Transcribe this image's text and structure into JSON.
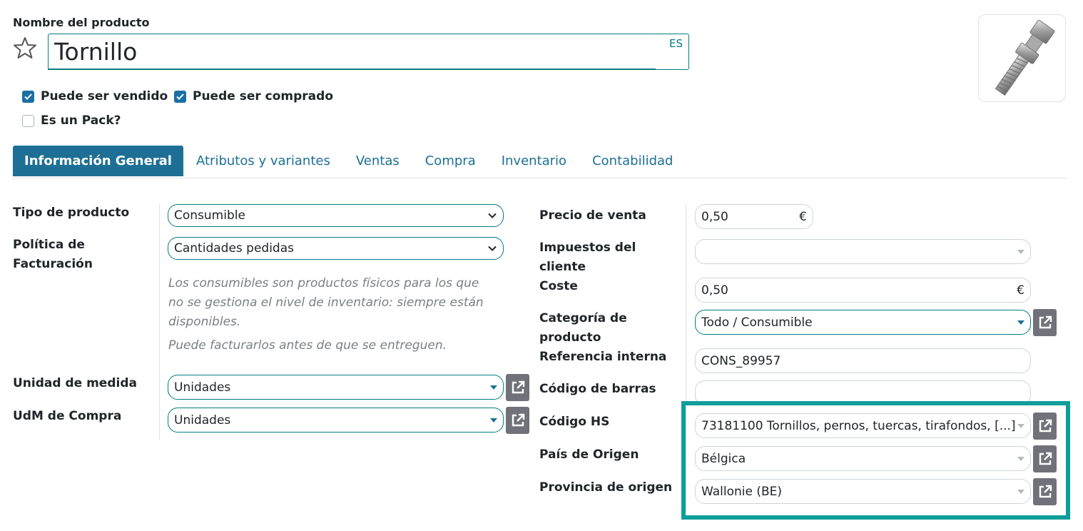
{
  "header": {
    "name_label": "Nombre del producto",
    "product_name": "Tornillo",
    "lang_code": "ES"
  },
  "options": {
    "can_be_sold": {
      "label": "Puede ser vendido",
      "checked": true
    },
    "can_be_purchased": {
      "label": "Puede ser comprado",
      "checked": true
    },
    "is_pack": {
      "label": "Es un Pack?",
      "checked": false
    }
  },
  "tabs": [
    {
      "label": "Información General",
      "active": true
    },
    {
      "label": "Atributos y variantes",
      "active": false
    },
    {
      "label": "Ventas",
      "active": false
    },
    {
      "label": "Compra",
      "active": false
    },
    {
      "label": "Inventario",
      "active": false
    },
    {
      "label": "Contabilidad",
      "active": false
    }
  ],
  "left": {
    "product_type": {
      "label": "Tipo de producto",
      "value": "Consumible"
    },
    "invoice_policy": {
      "label_line1": "Política de",
      "label_line2": "Facturación",
      "value": "Cantidades pedidas"
    },
    "help_text_1": [
      "Los consumibles son productos físicos para los que",
      "no se gestiona el nivel de inventario: siempre están",
      "disponibles."
    ],
    "help_text_2": "Puede facturarlos antes de que se entreguen.",
    "uom": {
      "label": "Unidad de medida",
      "value": "Unidades"
    },
    "purchase_uom": {
      "label": "UdM de Compra",
      "value": "Unidades"
    }
  },
  "right": {
    "sale_price": {
      "label": "Precio de venta",
      "value": "0,50",
      "currency": "€"
    },
    "customer_taxes": {
      "label_line1": "Impuestos del",
      "label_line2": "cliente",
      "value": ""
    },
    "cost": {
      "label": "Coste",
      "value": "0,50",
      "currency": "€"
    },
    "category": {
      "label_line1": "Categoría de",
      "label_line2": "producto",
      "value": "Todo / Consumible"
    },
    "internal_ref": {
      "label": "Referencia interna",
      "value": "CONS_89957"
    },
    "barcode": {
      "label": "Código de barras",
      "value": ""
    },
    "hs_code": {
      "label": "Código HS",
      "value": "73181100 Tornillos, pernos, tuercas, tirafondos, [...]"
    },
    "origin_country": {
      "label": "País de Origen",
      "value": "Bélgica"
    },
    "origin_state": {
      "label": "Provincia de origen",
      "value": "Wallonie (BE)"
    }
  },
  "colors": {
    "primary": "#1d6f95",
    "accent": "#017e84",
    "highlight": "#0e9e9a",
    "ext_button": "#71717a"
  }
}
